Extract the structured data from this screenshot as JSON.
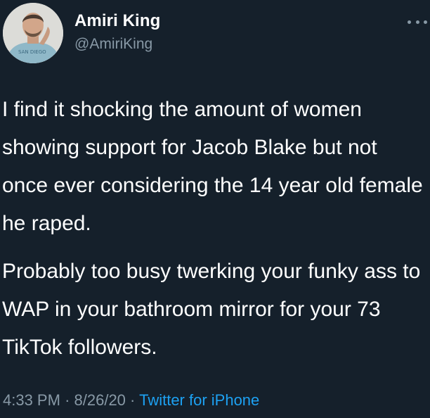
{
  "user": {
    "name": "Amiri King",
    "handle": "@AmiriKing",
    "avatar_icon": "profile-photo",
    "avatar_shirt_text": "SAN DIEGO"
  },
  "more_icon": "more-horizontal-icon",
  "tweet": {
    "paragraphs": [
      "I find it shocking the amount of women showing support for Jacob Blake but not once ever considering the 14 year old female he raped.",
      "Probably too busy twerking your funky ass to WAP in your bathroom mirror for your 73 TikTok followers."
    ]
  },
  "meta": {
    "time": "4:33 PM",
    "separator": "·",
    "date": "8/26/20",
    "source": "Twitter for iPhone"
  },
  "colors": {
    "background": "#15202b",
    "primary_text": "#ffffff",
    "secondary_text": "#8899a6",
    "link": "#1da1f2"
  }
}
